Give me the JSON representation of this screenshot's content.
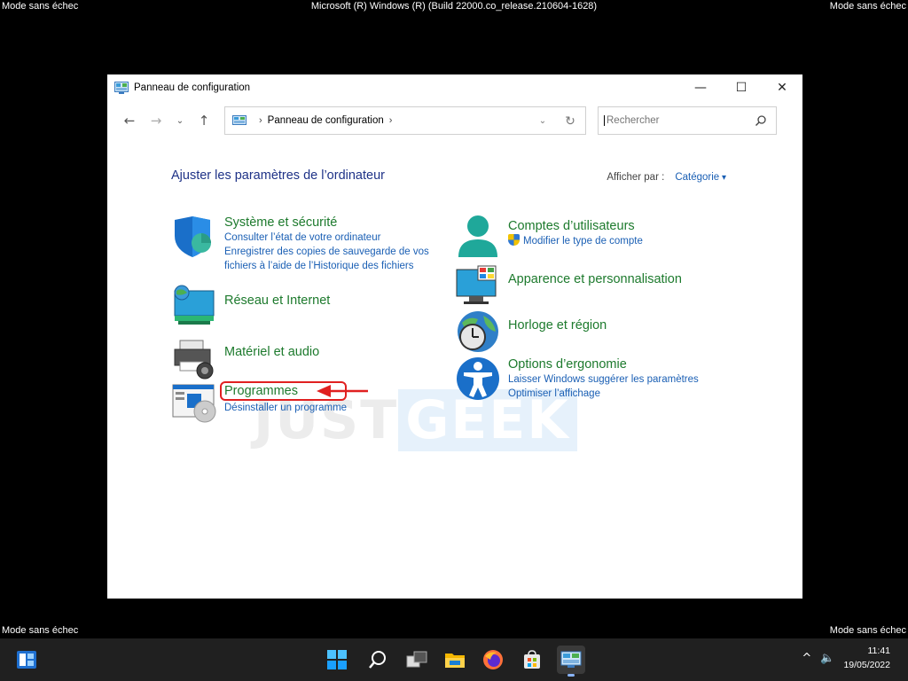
{
  "safe_mode_label": "Mode sans échec",
  "build_text": "Microsoft (R) Windows (R) (Build 22000.co_release.210604-1628)",
  "window": {
    "title": "Panneau de configuration",
    "minimize": "—",
    "maximize": "☐",
    "close": "✕"
  },
  "nav": {
    "back": "←",
    "forward": "→",
    "recent": "⌄",
    "up": "↑",
    "address": "Panneau de configuration",
    "address_sep": "›",
    "address_end": "›",
    "address_drop": "⌄",
    "refresh": "↻",
    "search_placeholder": "Rechercher"
  },
  "heading": "Ajuster les paramètres de l’ordinateur",
  "view_by": {
    "label": "Afficher par :",
    "value": "Catégorie"
  },
  "categories": {
    "systeme": {
      "title": "Système et sécurité",
      "links": [
        "Consulter l’état de votre ordinateur",
        "Enregistrer des copies de sauvegarde de vos",
        "fichiers à l’aide de l’Historique des fichiers"
      ]
    },
    "reseau": {
      "title": "Réseau et Internet"
    },
    "materiel": {
      "title": "Matériel et audio"
    },
    "programmes": {
      "title": "Programmes",
      "links": [
        "Désinstaller un programme"
      ]
    },
    "comptes": {
      "title": "Comptes d’utilisateurs",
      "links": [
        "Modifier le type de compte"
      ]
    },
    "apparence": {
      "title": "Apparence et personnalisation"
    },
    "horloge": {
      "title": "Horloge et région"
    },
    "ergonomie": {
      "title": "Options d’ergonomie",
      "links": [
        "Laisser Windows suggérer les paramètres",
        "Optimiser l’affichage"
      ]
    }
  },
  "watermark": {
    "part1": "JUST",
    "part2": "GEEK"
  },
  "taskbar": {
    "time": "11:41",
    "date": "19/05/2022",
    "tray_chevron": "^",
    "volume": "🔈"
  },
  "colors": {
    "link": "#1a5fb4",
    "category_title": "#1d7a2d",
    "heading": "#1e3287",
    "highlight": "#e02020",
    "taskbar": "#202020"
  }
}
